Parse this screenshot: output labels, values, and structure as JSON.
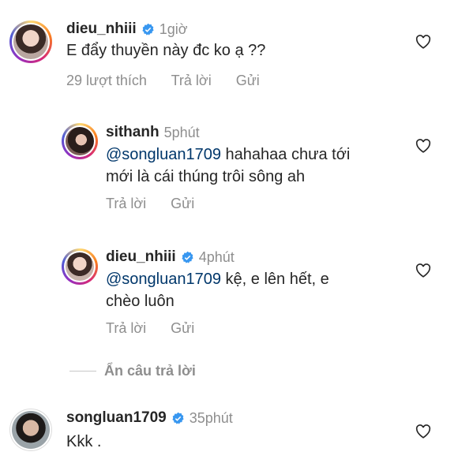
{
  "comments": [
    {
      "username": "dieu_nhiii",
      "time": "1giờ",
      "text": "E đẩy thuyền này đc ko ạ ??",
      "likes": "29 lượt thích",
      "reply": "Trả lời",
      "send": "Gửi"
    },
    {
      "username": "sithanh",
      "time": "5phút",
      "mention": "@songluan1709",
      "text_line1": "hahahaa chưa tới",
      "text_line2": "mới là cái thúng trôi sông ah",
      "reply": "Trả lời",
      "send": "Gửi"
    },
    {
      "username": "dieu_nhiii",
      "time": "4phút",
      "mention": "@songluan1709",
      "text_line1": "kệ, e lên hết, e",
      "text_line2": "chèo luôn",
      "reply": "Trả lời",
      "send": "Gửi"
    },
    {
      "username": "songluan1709",
      "time": "35phút",
      "text": "Kkk ."
    }
  ],
  "hide_replies": "Ẩn câu trả lời",
  "colors": {
    "verified": "#3897f0",
    "mention": "#00376b",
    "muted": "#8e8e8e"
  }
}
